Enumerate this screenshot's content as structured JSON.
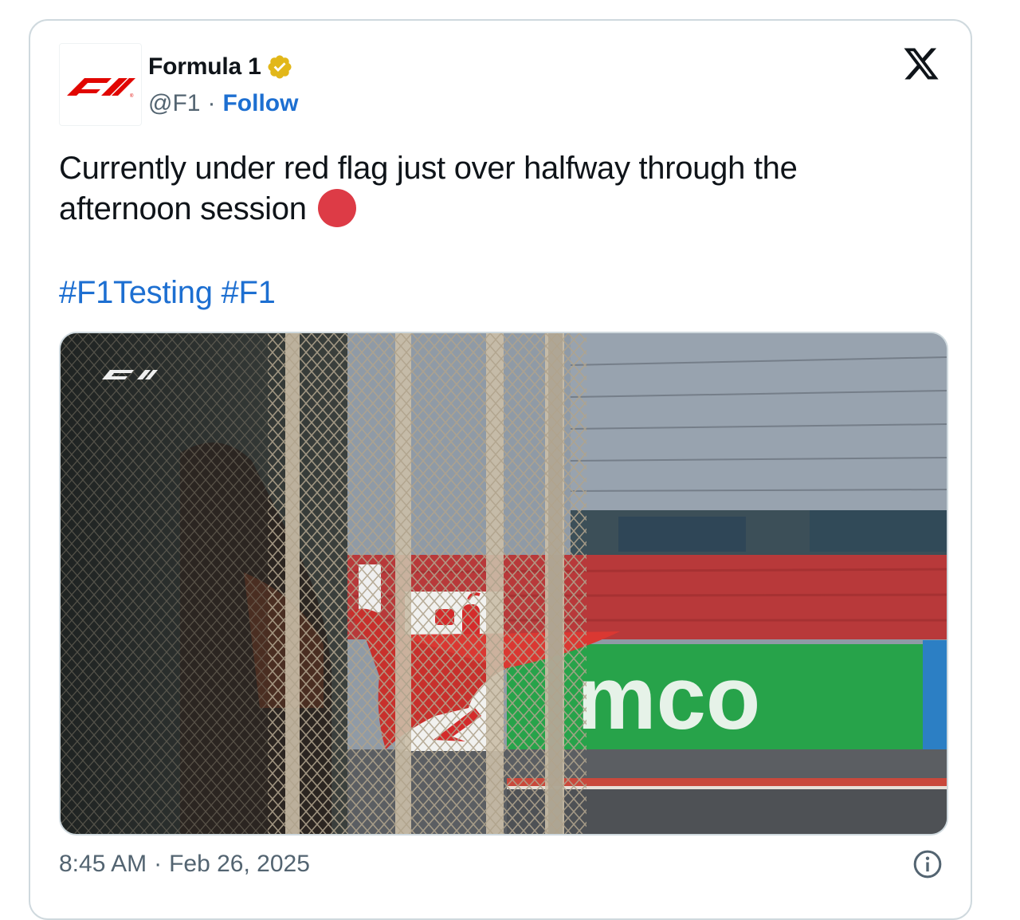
{
  "tweet": {
    "author_name": "Formula 1",
    "handle": "@F1",
    "separator": "·",
    "follow_label": "Follow",
    "text": "Currently under red flag just over halfway through the afternoon session",
    "emoji": "red-circle",
    "hashtags": [
      "#F1Testing",
      "#F1"
    ],
    "time": "8:45 AM",
    "date": "Feb 26, 2025"
  },
  "media": {
    "sign_text": "mco"
  },
  "icons": {
    "avatar": "f1-logo",
    "verified": "verified-badge-icon",
    "platform": "x-logo-icon",
    "info": "info-icon"
  },
  "colors": {
    "link": "#1d6fd1",
    "text": "#0f1419",
    "muted": "#536471",
    "border": "#cfd9de",
    "f1_red": "#e10600",
    "red_dot": "#dd3b46",
    "verified_gold": "#e2b719"
  }
}
